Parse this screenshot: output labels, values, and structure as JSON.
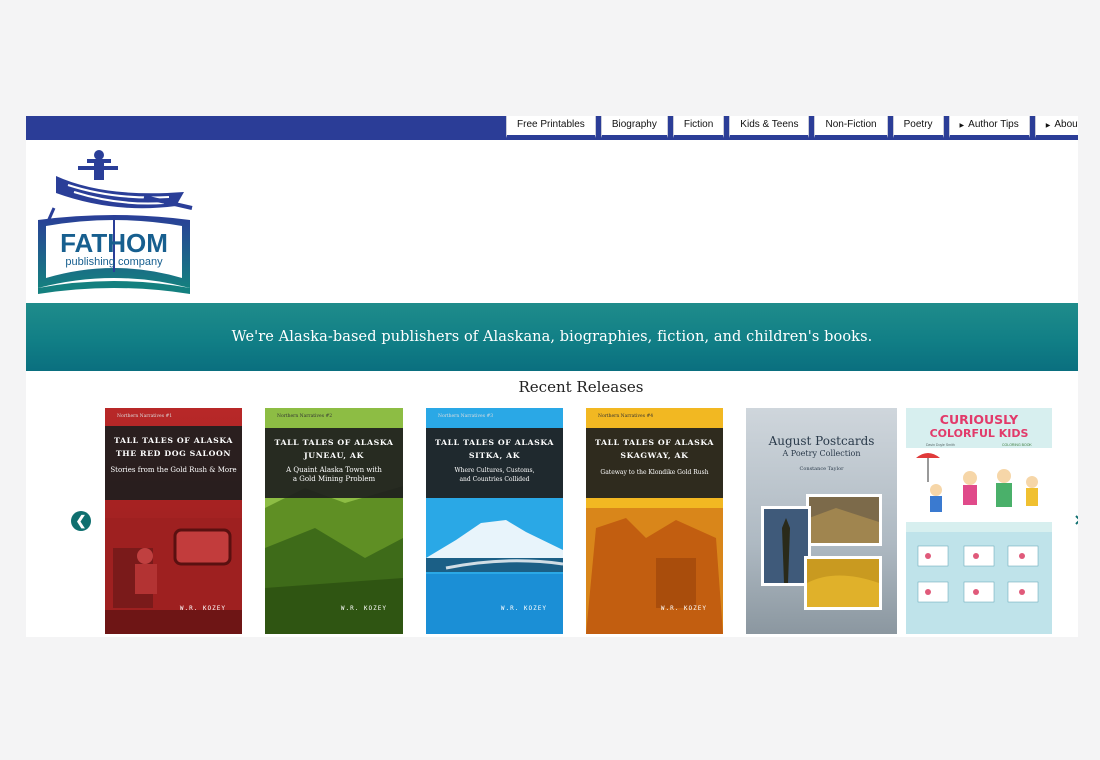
{
  "nav": {
    "items": [
      {
        "label": "Free Printables",
        "caret": false
      },
      {
        "label": "Biography",
        "caret": false
      },
      {
        "label": "Fiction",
        "caret": false
      },
      {
        "label": "Kids & Teens",
        "caret": false
      },
      {
        "label": "Non-Fiction",
        "caret": false
      },
      {
        "label": "Poetry",
        "caret": false
      },
      {
        "label": "Author Tips",
        "caret": true
      },
      {
        "label": "About Us",
        "caret": true
      }
    ]
  },
  "logo": {
    "name": "FATHOM",
    "tagline": "publishing company"
  },
  "banner": {
    "text": "We're Alaska-based publishers of Alaskana, biographies, fiction, and children's books."
  },
  "releases": {
    "title": "Recent Releases",
    "books": [
      {
        "series": "Northern Narratives #1",
        "title_line1": "TALL TALES OF ALASKA",
        "title_line2": "THE RED DOG SALOON",
        "subtitle": "Stories from the Gold Rush & More",
        "author": "W.R. KOZEY",
        "bar": "#c22b2b"
      },
      {
        "series": "Northern Narratives #2",
        "title_line1": "TALL TALES OF ALASKA",
        "title_line2": "JUNEAU, AK",
        "subtitle": "A Quaint Alaska Town with a Gold Mining Problem",
        "author": "W.R. KOZEY",
        "bar": "#6f9a2a"
      },
      {
        "series": "Northern Narratives #3",
        "title_line1": "TALL TALES OF ALASKA",
        "title_line2": "SITKA, AK",
        "subtitle": "Where Cultures, Customs, and Countries Collided",
        "author": "W.R. KOZEY",
        "bar": "#1e7fc5"
      },
      {
        "series": "Northern Narratives #4",
        "title_line1": "TALL TALES OF ALASKA",
        "title_line2": "SKAGWAY, AK",
        "subtitle": "Gateway to the Klondike Gold Rush",
        "author": "W.R. KOZEY",
        "bar": "#d68a12"
      },
      {
        "title": "August Postcards",
        "subtitle": "A Poetry Collection",
        "author": "Constance Taylor"
      },
      {
        "title_line1": "CURIOUSLY",
        "title_line2": "COLORFUL KIDS",
        "author": "Davin Doyle Smith",
        "badge": "COLORING BOOK"
      }
    ]
  },
  "carousel": {
    "prev_icon": "chevron-left-icon",
    "next_icon": "chevron-right-icon"
  },
  "colors": {
    "nav_bar": "#2b3d97",
    "banner": "#117f86",
    "accent": "#0e6f6f"
  }
}
